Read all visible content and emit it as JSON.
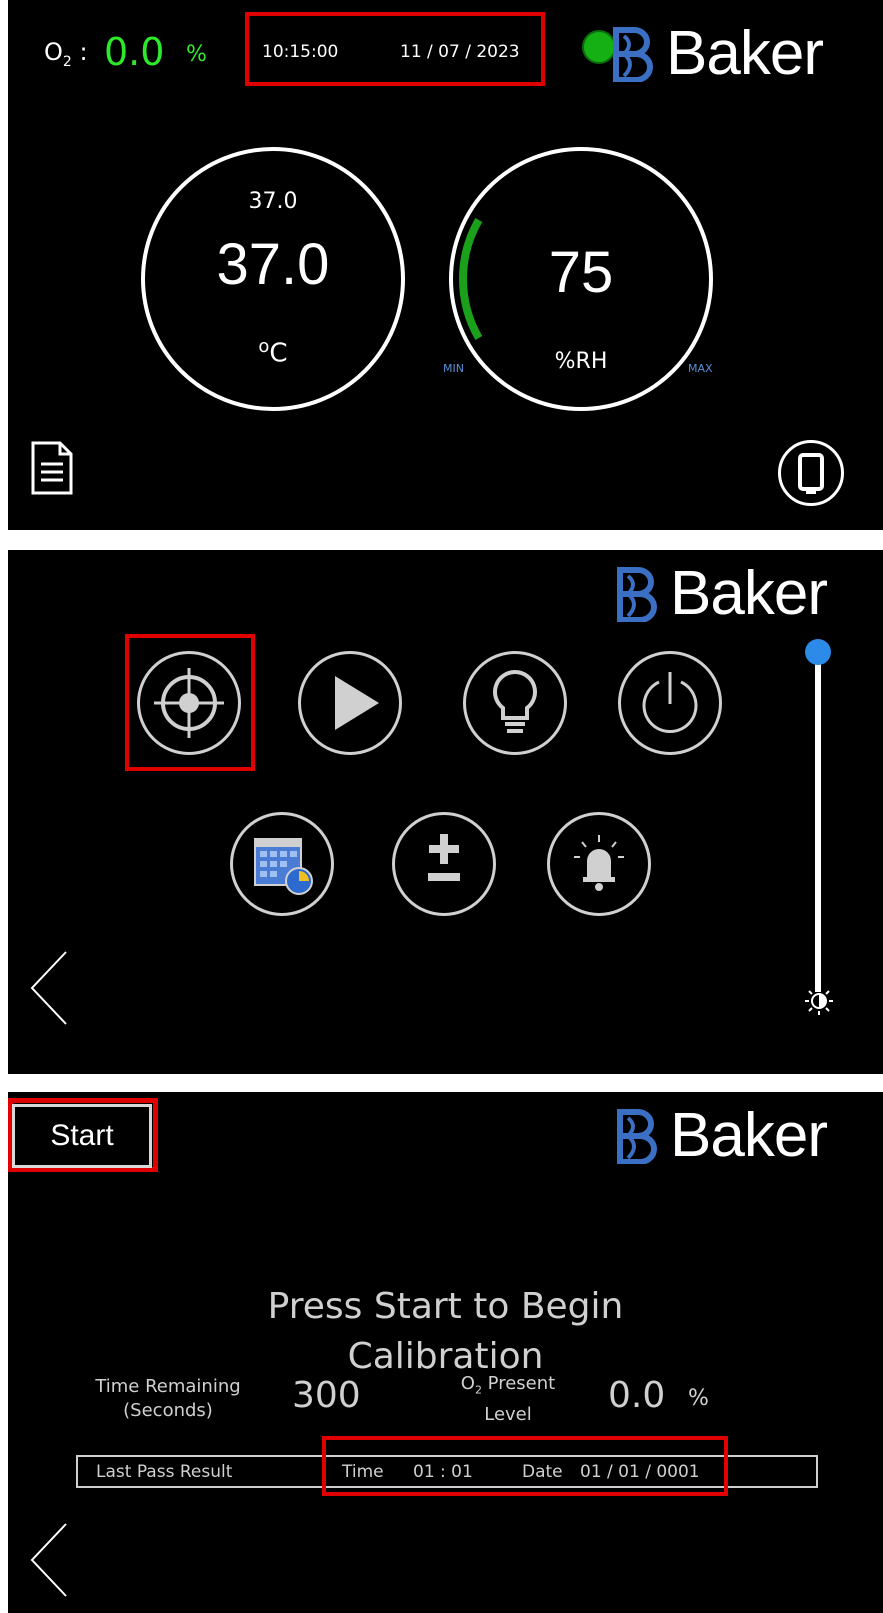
{
  "panel_home": {
    "o2_label": "O",
    "o2_sub": "2",
    "o2_colon": ":",
    "o2_value": "0.0",
    "o2_unit": "%",
    "time": "10:15:00",
    "date": "11 / 07 / 2023",
    "status_color": "#14b014",
    "brand": "Baker",
    "temperature": {
      "setpoint": "37.0",
      "value": "37.0",
      "unit_sup": "o",
      "unit": "C"
    },
    "humidity": {
      "value": "75",
      "unit": "%RH",
      "min_label": "MIN",
      "max_label": "MAX",
      "arc_color": "#1aa01a",
      "level_fraction": 0.2
    },
    "icons": {
      "left": "document-icon",
      "right": "device-icon"
    }
  },
  "panel_menu": {
    "brand": "Baker",
    "buttons": [
      {
        "name": "calibrate-target-icon"
      },
      {
        "name": "play-icon"
      },
      {
        "name": "light-bulb-icon"
      },
      {
        "name": "power-icon"
      },
      {
        "name": "schedule-calendar-icon"
      },
      {
        "name": "plus-minus-icon"
      },
      {
        "name": "alarm-bell-icon"
      }
    ],
    "brightness_level": 1.0,
    "slider_color": "#2c8ae8"
  },
  "panel_calibration": {
    "brand": "Baker",
    "start_label": "Start",
    "instruction_line1": "Press Start to Begin",
    "instruction_line2": "Calibration",
    "time_remaining_line1": "Time Remaining",
    "time_remaining_line2": "(Seconds)",
    "time_remaining_value": "300",
    "o2_present_o": "O",
    "o2_present_sub": "2",
    "o2_present_line1": " Present",
    "o2_present_line2": "Level",
    "o2_present_value": "0.0",
    "o2_present_unit": "%",
    "last_pass_label": "Last Pass Result",
    "time_label": "Time",
    "time_value": "01 : 01",
    "date_label": "Date",
    "date_value": "01 / 01 / 0001"
  },
  "colors": {
    "highlight": "#e00000",
    "brand_blue": "#3a6fc4",
    "o2_green": "#2ee82e"
  }
}
